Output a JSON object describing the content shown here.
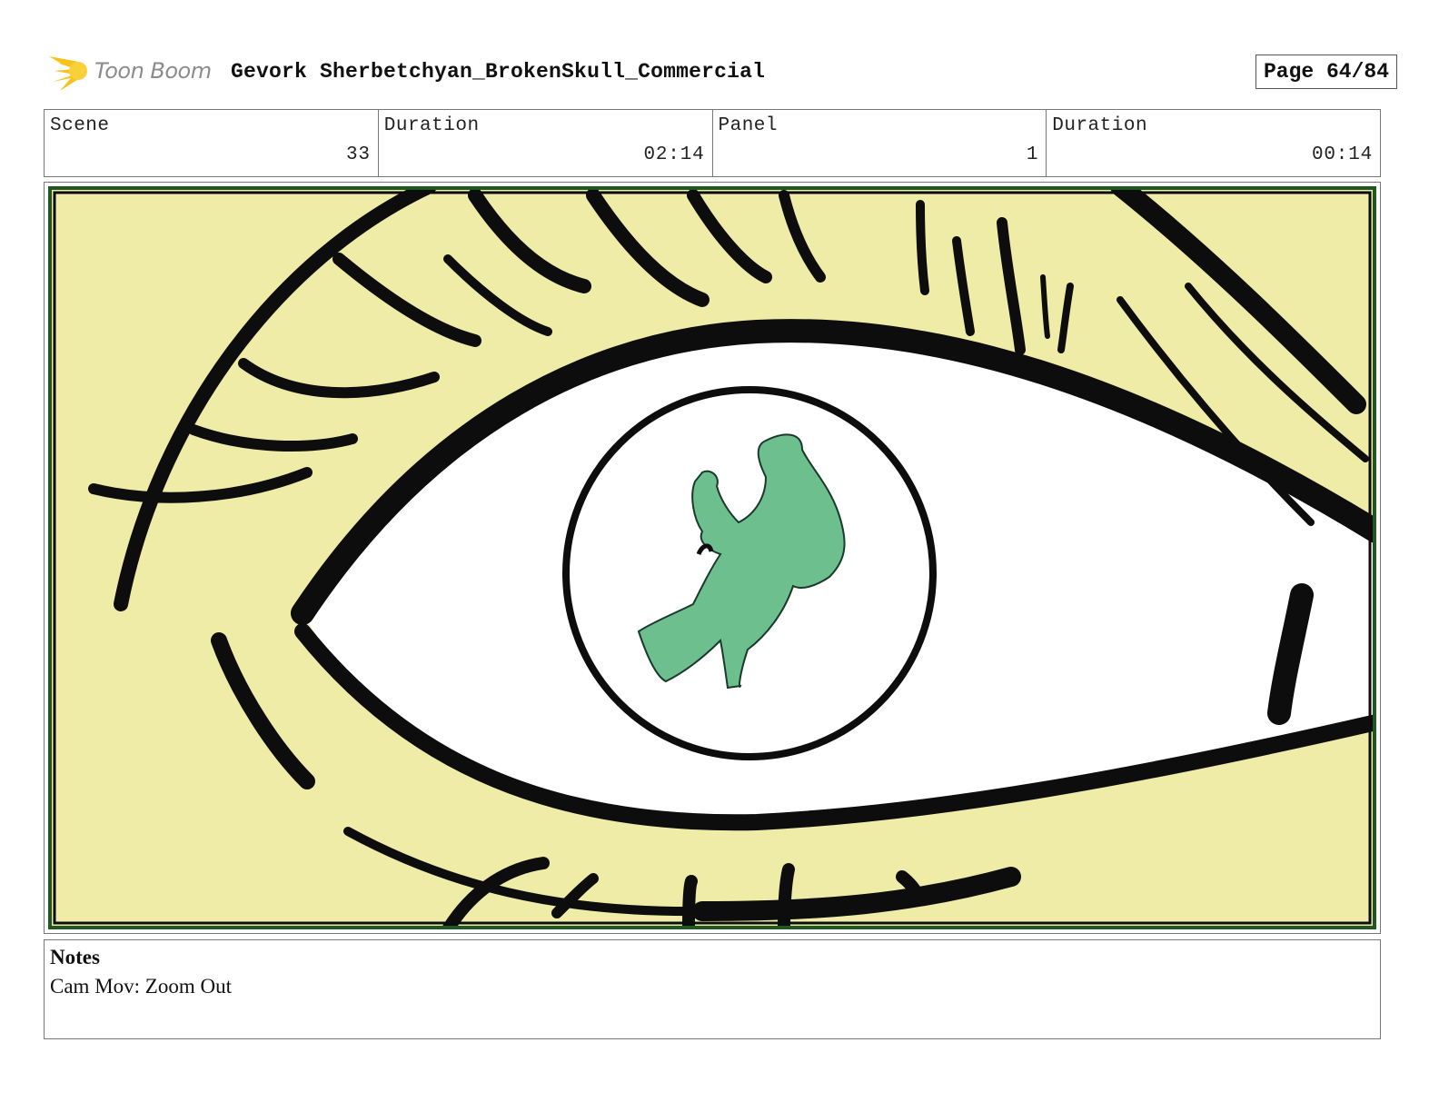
{
  "header": {
    "logo_text": "Toon Boom",
    "project_title": "Gevork Sherbetchyan_BrokenSkull_Commercial",
    "page_label": "Page 64/84"
  },
  "info": {
    "scene_label": "Scene",
    "scene_value": "33",
    "scene_duration_label": "Duration",
    "scene_duration_value": "02:14",
    "panel_label": "Panel",
    "panel_value": "1",
    "panel_duration_label": "Duration",
    "panel_duration_value": "00:14"
  },
  "panel": {
    "colors": {
      "background": "#eeeca6",
      "border": "#1e5a20",
      "ink": "#0d0d0d",
      "eye_white": "#ffffff",
      "figure": "#6dbf8e"
    }
  },
  "notes": {
    "title": "Notes",
    "text": "Cam Mov: Zoom Out"
  }
}
